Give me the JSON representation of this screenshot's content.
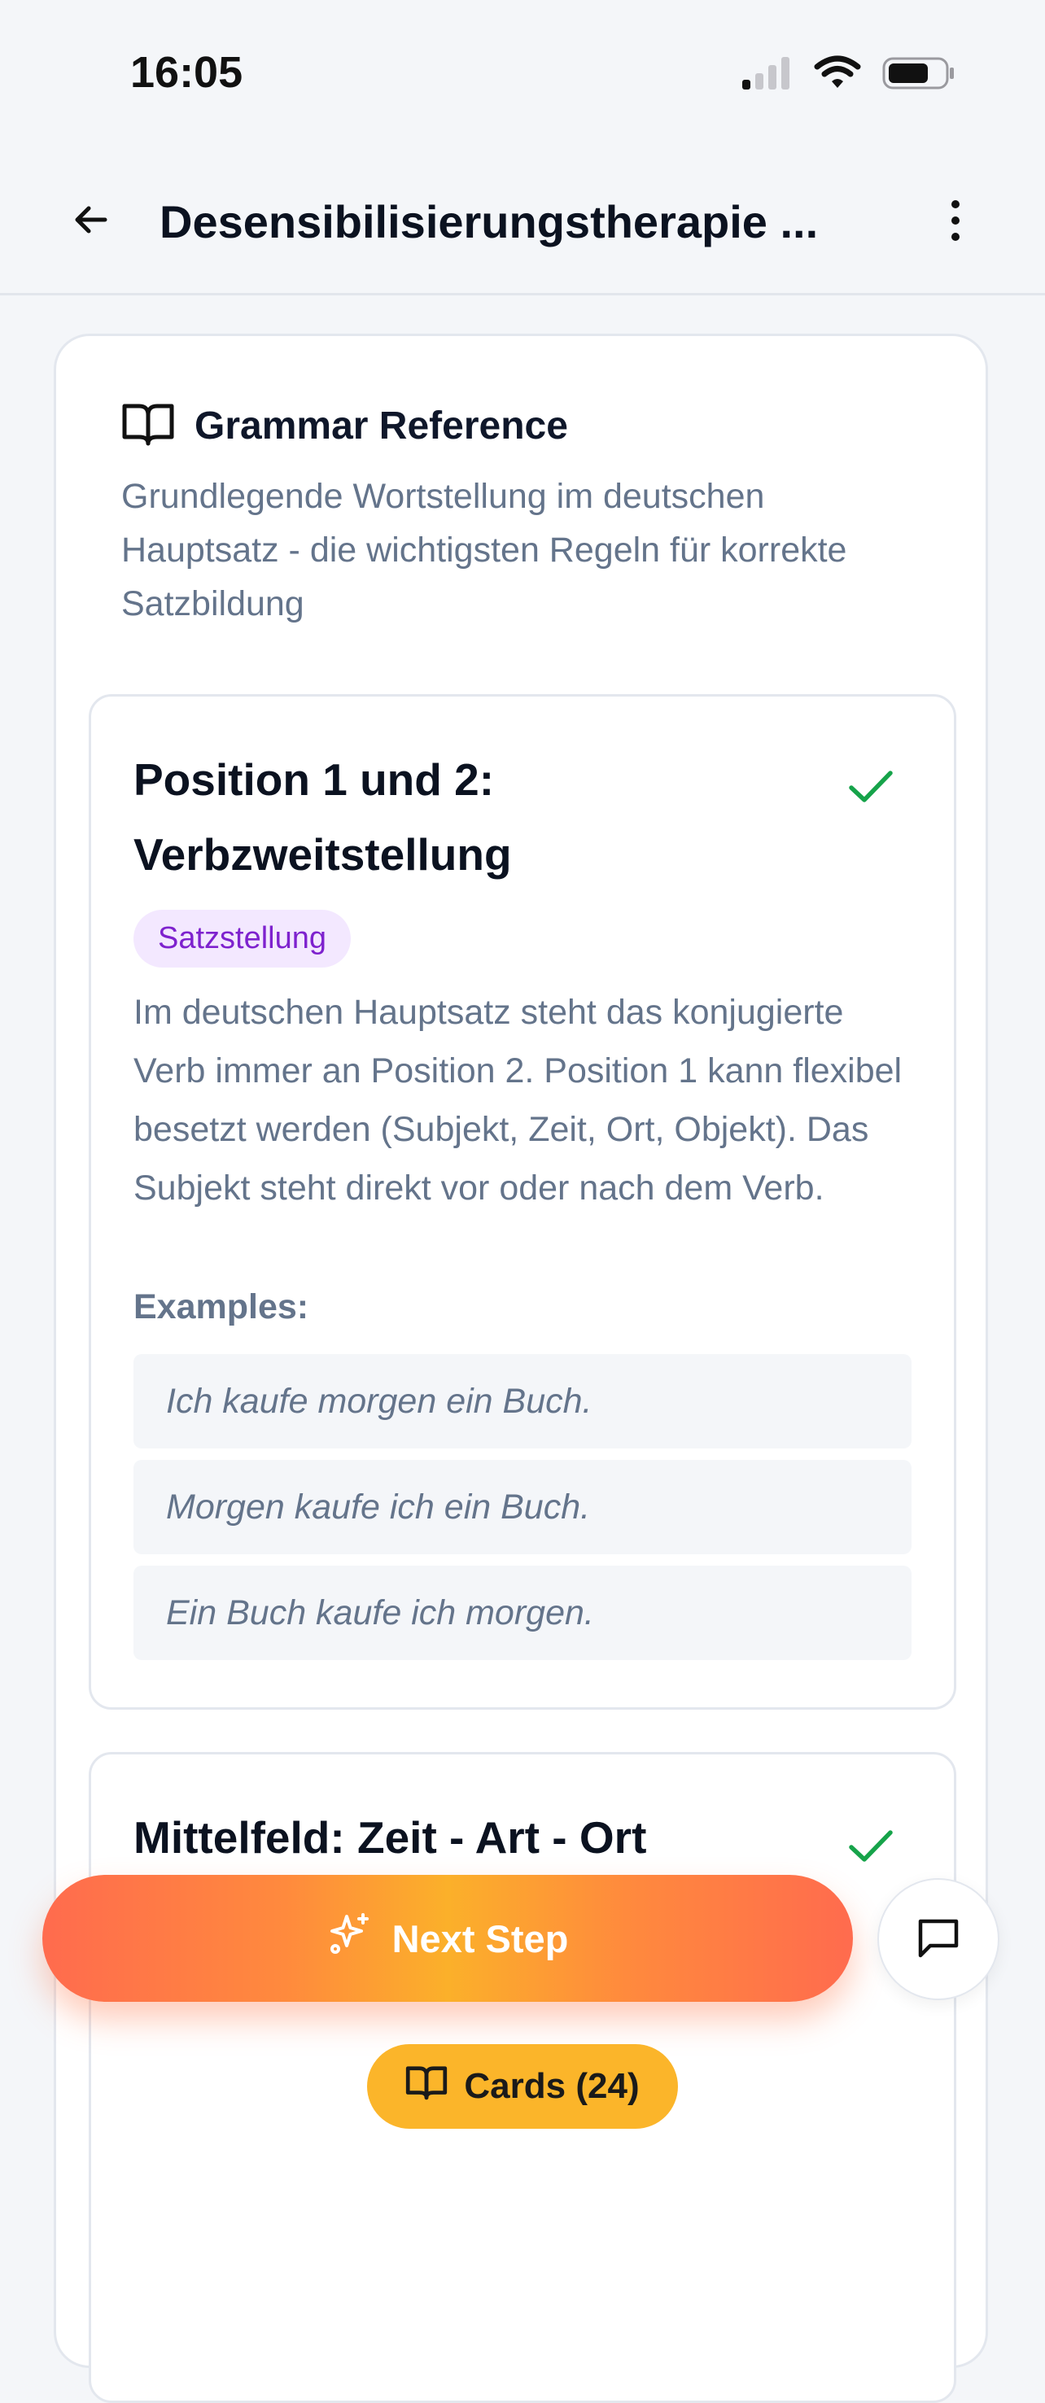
{
  "status_bar": {
    "time": "16:05",
    "icons": [
      "cellular-signal-icon",
      "wifi-icon",
      "battery-icon"
    ]
  },
  "nav": {
    "back_icon": "arrow-left-icon",
    "title": "Desensibilisierungstherapie ...",
    "more_icon": "more-vertical-icon"
  },
  "grammar_reference": {
    "icon": "book-open-icon",
    "title": "Grammar Reference",
    "description": "Grundlegende Wortstellung im deutschen Hauptsatz - die wichtigsten Regeln für korrekte Satzbildung",
    "rules": [
      {
        "title_line1": "Position 1 und 2:",
        "title_line2": "Verbzweitstellung",
        "completed_icon": "check-icon",
        "tag": "Satzstellung",
        "description": "Im deutschen Hauptsatz steht das konjugierte Verb immer an Position 2. Position 1 kann flexibel besetzt werden (Subjekt, Zeit, Ort, Objekt). Das Subjekt steht direkt vor oder nach dem Verb.",
        "examples_label": "Examples:",
        "examples": [
          "Ich kaufe morgen ein Buch.",
          "Morgen kaufe ich ein Buch.",
          "Ein Buch kaufe ich morgen."
        ]
      },
      {
        "title": "Mittelfeld: Zeit - Art - Ort",
        "completed_icon": "check-icon"
      }
    ]
  },
  "actions": {
    "next_step_label": "Next Step",
    "next_step_icon": "sparkles-icon",
    "chat_icon": "message-square-icon",
    "cards_label": "Cards (24)",
    "cards_icon": "book-open-icon"
  },
  "colors": {
    "accent_orange": "#ff6b4e",
    "accent_yellow": "#fbb52a",
    "check_green": "#16a34a",
    "tag_purple": "#7e22ce",
    "tag_bg": "#f3e8ff"
  }
}
